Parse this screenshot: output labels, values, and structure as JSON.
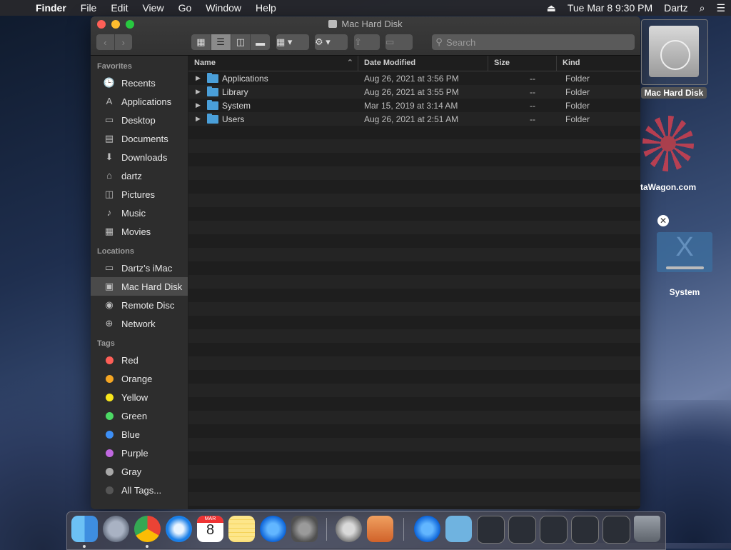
{
  "menubar": {
    "apple": "",
    "app": "Finder",
    "menus": [
      "File",
      "Edit",
      "View",
      "Go",
      "Window",
      "Help"
    ],
    "datetime": "Tue Mar 8  9:30 PM",
    "user": "Dartz",
    "eject_icon": "⏏",
    "search_icon": "⌕",
    "list_icon": "☰"
  },
  "window": {
    "title": "Mac Hard Disk",
    "search_placeholder": "Search",
    "columns": {
      "name": "Name",
      "date": "Date Modified",
      "size": "Size",
      "kind": "Kind"
    },
    "rows": [
      {
        "name": "Applications",
        "date": "Aug 26, 2021 at 3:56 PM",
        "size": "--",
        "kind": "Folder"
      },
      {
        "name": "Library",
        "date": "Aug 26, 2021 at 3:55 PM",
        "size": "--",
        "kind": "Folder"
      },
      {
        "name": "System",
        "date": "Mar 15, 2019 at 3:14 AM",
        "size": "--",
        "kind": "Folder"
      },
      {
        "name": "Users",
        "date": "Aug 26, 2021 at 2:51 AM",
        "size": "--",
        "kind": "Folder"
      }
    ]
  },
  "sidebar": {
    "favorites_header": "Favorites",
    "favorites": [
      {
        "label": "Recents",
        "icon": "🕒"
      },
      {
        "label": "Applications",
        "icon": "A"
      },
      {
        "label": "Desktop",
        "icon": "▭"
      },
      {
        "label": "Documents",
        "icon": "▤"
      },
      {
        "label": "Downloads",
        "icon": "⬇"
      },
      {
        "label": "dartz",
        "icon": "⌂"
      },
      {
        "label": "Pictures",
        "icon": "◫"
      },
      {
        "label": "Music",
        "icon": "♪"
      },
      {
        "label": "Movies",
        "icon": "▦"
      }
    ],
    "locations_header": "Locations",
    "locations": [
      {
        "label": "Dartz’s iMac",
        "icon": "▭"
      },
      {
        "label": "Mac Hard Disk",
        "icon": "▣"
      },
      {
        "label": "Remote Disc",
        "icon": "◉"
      },
      {
        "label": "Network",
        "icon": "⊕"
      }
    ],
    "tags_header": "Tags",
    "tags": [
      {
        "label": "Red",
        "color": "#fe5f57"
      },
      {
        "label": "Orange",
        "color": "#f5a623"
      },
      {
        "label": "Yellow",
        "color": "#f8e71c"
      },
      {
        "label": "Green",
        "color": "#4cd964"
      },
      {
        "label": "Blue",
        "color": "#3d8ff5"
      },
      {
        "label": "Purple",
        "color": "#c068e0"
      },
      {
        "label": "Gray",
        "color": "#a8a8a8"
      },
      {
        "label": "All Tags...",
        "color": "#555555"
      }
    ]
  },
  "desktop": {
    "hd_label": "Mac Hard Disk",
    "web_label": "taWagon.com",
    "system_label": "System",
    "close_glyph": "✕"
  },
  "dock": {
    "calendar_month": "MAR",
    "calendar_day": "8"
  }
}
